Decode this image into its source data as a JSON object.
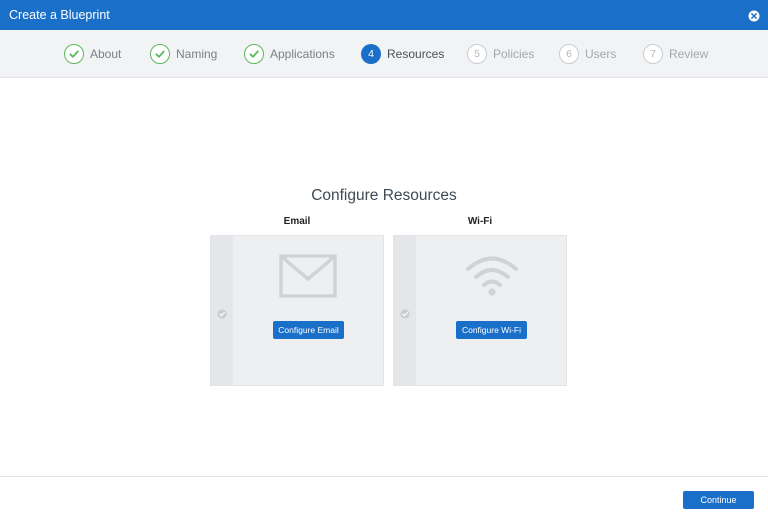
{
  "window": {
    "title": "Create a Blueprint",
    "close_icon": "close-circle-icon"
  },
  "steps": [
    {
      "number": "1",
      "label": "About",
      "state": "done",
      "icon": "check-circle-icon"
    },
    {
      "number": "2",
      "label": "Naming",
      "state": "done",
      "icon": "check-circle-icon"
    },
    {
      "number": "3",
      "label": "Applications",
      "state": "done",
      "icon": "check-circle-icon"
    },
    {
      "number": "4",
      "label": "Resources",
      "state": "active"
    },
    {
      "number": "5",
      "label": "Policies",
      "state": "pending"
    },
    {
      "number": "6",
      "label": "Users",
      "state": "pending"
    },
    {
      "number": "7",
      "label": "Review",
      "state": "pending"
    }
  ],
  "main": {
    "heading": "Configure Resources",
    "cards": [
      {
        "title": "Email",
        "icon": "envelope-icon",
        "status_icon": "check-circle-icon",
        "button": "Configure Email"
      },
      {
        "title": "Wi-Fi",
        "icon": "wifi-icon",
        "status_icon": "check-circle-icon",
        "button": "Configure Wi-Fi"
      }
    ]
  },
  "footer": {
    "continue_label": "Continue"
  },
  "colors": {
    "accent": "#1a6fc9",
    "success": "#5cb85c",
    "pending": "#c8ccd1",
    "card_bg": "#eeeff1"
  }
}
